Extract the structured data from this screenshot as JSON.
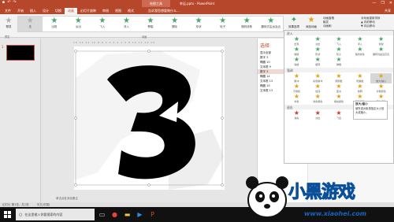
{
  "titlebar": {
    "doc_title": "幸运.pptx - PowerPoint",
    "context_tab": "绘图工具",
    "minimize": "—",
    "restore": "❐",
    "close": "✕"
  },
  "tabs": {
    "items": [
      "文件",
      "开始",
      "插入",
      "设计",
      "切换",
      "动画",
      "幻灯片放映",
      "审阅",
      "视图",
      "格式"
    ],
    "active_index": 5,
    "tell_me": "告诉我您想要做什么…",
    "share": "共享"
  },
  "ribbon": {
    "preview_label": "预览",
    "gallery": [
      "无",
      "出现",
      "淡出",
      "飞入",
      "浮入",
      "劈裂",
      "擦除",
      "形状",
      "轮子",
      "随机线条",
      "翻转式由远及近"
    ],
    "gallery_selected": 0,
    "effect_options": "效果选项",
    "add_animation": "添加动画",
    "animation_pane": "动画窗格",
    "trigger": "触发",
    "animation_painter": "动画刷",
    "timing": [
      "开始:",
      "持续时间:",
      "延迟:"
    ],
    "reorder": "对动画重新排序",
    "move_earlier": "▲ 向前移动",
    "move_later": "▼ 向后移动",
    "group_labels": [
      "预览",
      "动画",
      "高级动画",
      "计时"
    ]
  },
  "slide_panel": {
    "slide_number": "1"
  },
  "editor": {
    "ruler": "16·14·12·10·8·6·4·2·0·2·4·6·8·10·12·14·16",
    "notes_placeholder": "单击此处添加备注"
  },
  "selection_pane": {
    "title": "选择",
    "rows": [
      "显示全部",
      "数字 3",
      "椭圆 10",
      "文本框 9",
      "数字 3",
      "椭圆 14",
      "文本框 13",
      "椭圆 15",
      "文本框 13"
    ],
    "selected_index": 4
  },
  "dropdown": {
    "sections": [
      {
        "header": "进入",
        "items": [
          "出现",
          "淡出",
          "飞入",
          "浮入",
          "劈裂",
          "擦除",
          "形状",
          "轮子",
          "随机线条",
          "翻转式由远及近",
          "缩放",
          "旋转",
          "弹跳"
        ],
        "color": "#4aa76b"
      },
      {
        "header": "强调",
        "items": [
          "脉冲",
          "彩色脉冲",
          "跷跷板",
          "陀螺旋",
          "放大/缩小",
          "不饱和",
          "加深",
          "变淡",
          "透明",
          "对象颜色",
          "补色",
          "线条颜色",
          "填充颜色",
          "画笔颜色",
          "字体颜色"
        ],
        "color": "#e3a21a"
      },
      {
        "header": "退出",
        "items": [
          "消失",
          "淡出",
          "飞出",
          "浮出",
          "劈裂"
        ],
        "color": "#cf3b2a"
      }
    ],
    "highlight_label": "放大/缩小"
  },
  "tooltip": {
    "title": "放大/缩小",
    "body": "使所选对象按指定大小放大或缩小。"
  },
  "statusbar": {
    "slide_info": "幻灯片 第1张，共1张",
    "language": "中文(中国)"
  },
  "taskbar": {
    "search_placeholder": "在这里输入你要搜索的内容"
  },
  "watermark": {
    "brand": "小黑游戏",
    "url": "www.xiaohei.com"
  },
  "colors": {
    "accent": "#b7472a",
    "entrance": "#4aa76b",
    "emphasis": "#e3a21a",
    "exit": "#cf3b2a"
  }
}
